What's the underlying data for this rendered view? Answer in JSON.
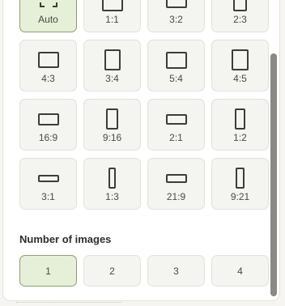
{
  "aspect_ratios": [
    {
      "label": "Auto",
      "icon": "auto-frame-icon",
      "w": 0,
      "h": 0,
      "selected": true
    },
    {
      "label": "1:1",
      "w": 1,
      "h": 1
    },
    {
      "label": "3:2",
      "w": 3,
      "h": 2
    },
    {
      "label": "2:3",
      "w": 2,
      "h": 3
    },
    {
      "label": "4:3",
      "w": 4,
      "h": 3
    },
    {
      "label": "3:4",
      "w": 3,
      "h": 4
    },
    {
      "label": "5:4",
      "w": 5,
      "h": 4
    },
    {
      "label": "4:5",
      "w": 4,
      "h": 5
    },
    {
      "label": "16:9",
      "w": 16,
      "h": 9
    },
    {
      "label": "9:16",
      "w": 9,
      "h": 16
    },
    {
      "label": "2:1",
      "w": 2,
      "h": 1
    },
    {
      "label": "1:2",
      "w": 1,
      "h": 2
    },
    {
      "label": "3:1",
      "w": 3,
      "h": 1
    },
    {
      "label": "1:3",
      "w": 1,
      "h": 3
    },
    {
      "label": "21:9",
      "w": 21,
      "h": 9
    },
    {
      "label": "9:21",
      "w": 9,
      "h": 21
    }
  ],
  "num_images": {
    "title": "Number of images",
    "options": [
      "1",
      "2",
      "3",
      "4"
    ],
    "selected": "1"
  },
  "colors": {
    "selected_bg": "#e6efd8",
    "selected_border": "#8f9c72",
    "tile_bg": "#f4f4f0"
  }
}
